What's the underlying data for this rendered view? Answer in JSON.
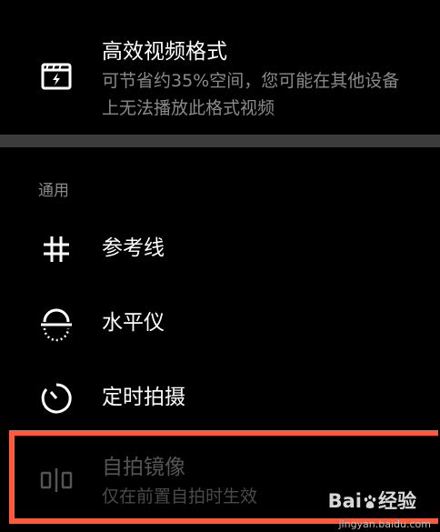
{
  "settings": {
    "hevc": {
      "title": "高效视频格式",
      "description_line1": "可节省约35%空间，您可能在其他设备",
      "description_line2": "上无法播放此格式视频",
      "icon": "video-format-icon"
    },
    "section_general": "通用",
    "items": [
      {
        "title": "参考线",
        "icon": "grid-icon"
      },
      {
        "title": "水平仪",
        "icon": "level-icon"
      },
      {
        "title": "定时拍摄",
        "icon": "timer-icon"
      }
    ],
    "mirror": {
      "title": "自拍镜像",
      "description": "仅在前置自拍时生效",
      "icon": "mirror-icon",
      "enabled": false
    }
  },
  "highlight_color": "#ff5a3a",
  "watermark": {
    "brand": "Bai",
    "brand_suffix": "经验",
    "url": "jingyan.baidu.com"
  }
}
